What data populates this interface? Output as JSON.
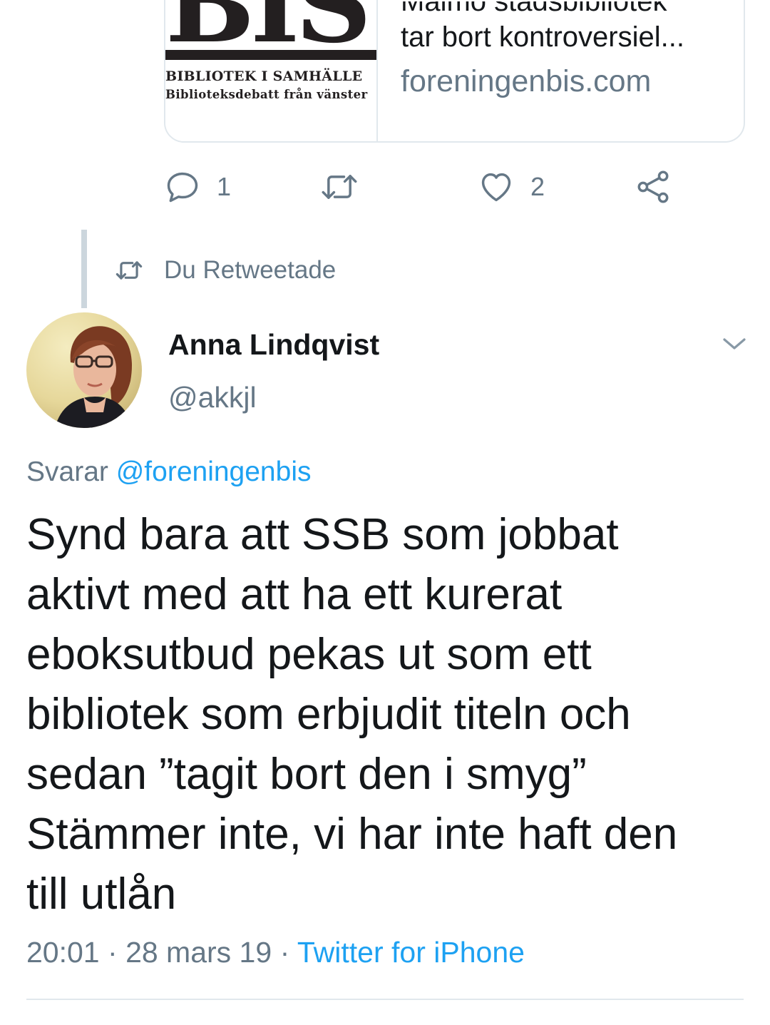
{
  "link_card": {
    "logo_big": "BIS",
    "logo_line1": "BIBLIOTEK I SAMHÄLLE",
    "logo_line2": "Biblioteksdebatt från vänster",
    "title_cut": "Malmö stadsbibliotek",
    "title": "tar bort kontroversiel...",
    "domain": "foreningenbis.com"
  },
  "actions": {
    "reply_count": "1",
    "like_count": "2",
    "icons": [
      "reply-icon",
      "retweet-icon",
      "like-icon",
      "share-icon"
    ]
  },
  "retweet_label": "Du Retweetade",
  "tweet": {
    "author_name": "Anna Lindqvist",
    "author_handle": "@akkjl",
    "replying_prefix": "Svarar",
    "replying_to": "@foreningenbis",
    "text_lines": [
      "Synd bara att SSB som jobbat",
      "aktivt med att ha ett kurerat",
      "eboksutbud pekas ut som ett",
      "bibliotek som erbjudit titeln och",
      "sedan ”tagit bort den i smyg”",
      "Stämmer inte, vi har inte haft den",
      "till utlån"
    ],
    "time": "20:01",
    "date": "28 mars 19",
    "source": "Twitter for iPhone"
  },
  "colors": {
    "secondary_text": "#657786",
    "link": "#1da1f2",
    "border": "#e1e8ed",
    "thread_line": "#ccd6dd"
  }
}
